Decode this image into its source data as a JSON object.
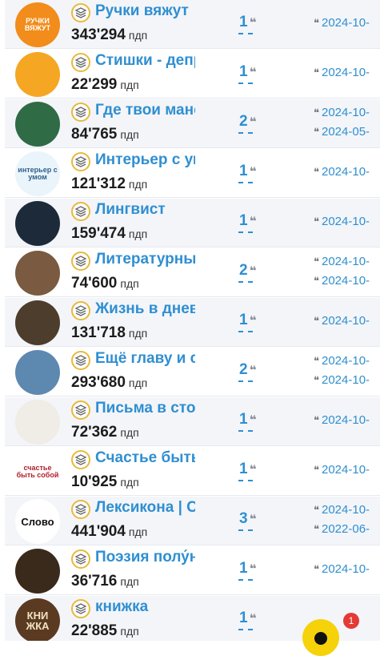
{
  "colors": {
    "link": "#2f8fd1",
    "row_alt": "#f3f5f9",
    "badge": "#e53935",
    "fab": "#f5d20a"
  },
  "rows": [
    {
      "title": "Ручки вяжут",
      "subs": "343'294",
      "unit": "пдп",
      "count": "1",
      "dates": [
        "2024-10-"
      ],
      "avatar_text": "РУЧКИ ВЯЖУТ",
      "avatar_bg": "#f28c1a",
      "avatar_fg": "#fff"
    },
    {
      "title": "Стишки - депр",
      "subs": "22'299",
      "unit": "пдп",
      "count": "1",
      "dates": [
        "2024-10-"
      ],
      "avatar_text": "",
      "avatar_bg": "#f5a623",
      "avatar_fg": "#fff"
    },
    {
      "title": "Где твои мане",
      "subs": "84'765",
      "unit": "пдп",
      "count": "2",
      "dates": [
        "2024-10-",
        "2024-05-"
      ],
      "avatar_text": "",
      "avatar_bg": "#2f6b45",
      "avatar_fg": "#fff"
    },
    {
      "title": "Интерьер с ум",
      "subs": "121'312",
      "unit": "пдп",
      "count": "1",
      "dates": [
        "2024-10-"
      ],
      "avatar_text": "интерьер с умом",
      "avatar_bg": "#eaf4fb",
      "avatar_fg": "#2f5f8a"
    },
    {
      "title": "Лингвист",
      "subs": "159'474",
      "unit": "пдп",
      "count": "1",
      "dates": [
        "2024-10-"
      ],
      "avatar_text": "",
      "avatar_bg": "#1d2a3a",
      "avatar_fg": "#fff"
    },
    {
      "title": "Литературны",
      "subs": "74'600",
      "unit": "пдп",
      "count": "2",
      "dates": [
        "2024-10-",
        "2024-10-"
      ],
      "avatar_text": "",
      "avatar_bg": "#7a5a40",
      "avatar_fg": "#fff"
    },
    {
      "title": "Жизнь в днев",
      "subs": "131'718",
      "unit": "пдп",
      "count": "1",
      "dates": [
        "2024-10-"
      ],
      "avatar_text": "",
      "avatar_bg": "#4d3d2d",
      "avatar_fg": "#fff"
    },
    {
      "title": "Ещё главу и с",
      "subs": "293'680",
      "unit": "пдп",
      "count": "2",
      "dates": [
        "2024-10-",
        "2024-10-"
      ],
      "avatar_text": "",
      "avatar_bg": "#5d88b0",
      "avatar_fg": "#fff"
    },
    {
      "title": "Письма в сто",
      "subs": "72'362",
      "unit": "пдп",
      "count": "1",
      "dates": [
        "2024-10-"
      ],
      "avatar_text": "",
      "avatar_bg": "#f0ece6",
      "avatar_fg": "#333"
    },
    {
      "title": "Счастье быть",
      "subs": "10'925",
      "unit": "пдп",
      "count": "1",
      "dates": [
        "2024-10-"
      ],
      "avatar_text": "счастье быть собой",
      "avatar_bg": "#ffffff",
      "avatar_fg": "#b21e2a"
    },
    {
      "title": "Лексикона | С",
      "subs": "441'904",
      "unit": "пдп",
      "count": "3",
      "dates": [
        "2024-10-",
        "2022-06-"
      ],
      "avatar_text": "Слово",
      "avatar_bg": "#ffffff",
      "avatar_fg": "#111"
    },
    {
      "title": "Поэзия полу́н",
      "subs": "36'716",
      "unit": "пдп",
      "count": "1",
      "dates": [
        "2024-10-"
      ],
      "avatar_text": "",
      "avatar_bg": "#3a2a1c",
      "avatar_fg": "#fff"
    },
    {
      "title": "книжка",
      "subs": "22'885",
      "unit": "пдп",
      "count": "1",
      "dates": [],
      "avatar_text": "КНИ ЖКА",
      "avatar_bg": "#5a3b22",
      "avatar_fg": "#f2e2c4"
    }
  ],
  "notification_count": "1"
}
